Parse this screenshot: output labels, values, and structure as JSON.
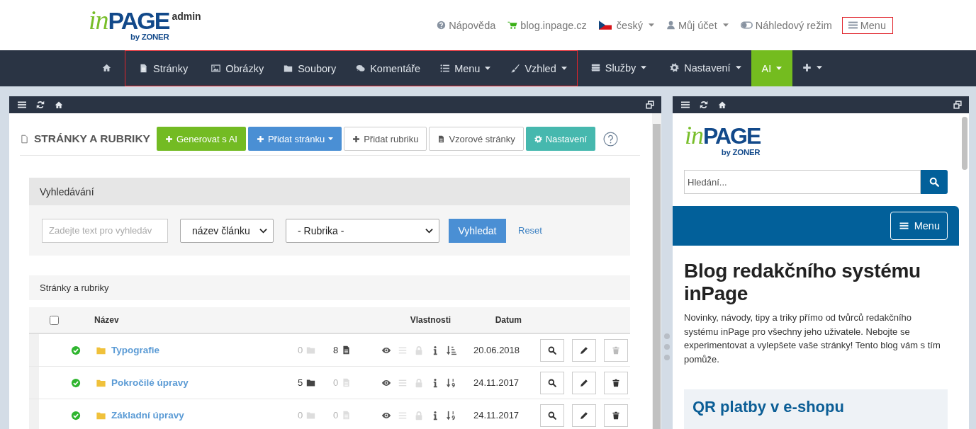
{
  "header": {
    "logo": {
      "script": "in",
      "word": "PAGE",
      "byline": "by ZONER",
      "badge": "admin"
    },
    "links": [
      {
        "label": "Nápověda"
      },
      {
        "label": "blog.inpage.cz"
      },
      {
        "label": "český",
        "dropdown": true
      },
      {
        "label": "Můj účet",
        "dropdown": true
      },
      {
        "label": "Náhledový režim"
      },
      {
        "label": "Menu",
        "highlighted": true
      }
    ]
  },
  "nav": {
    "groups": [
      {
        "items": [
          {
            "selected": false
          }
        ]
      },
      {
        "outlined": true,
        "items": [
          {
            "label": "Stránky",
            "selected": false
          },
          {
            "label": "Obrázky",
            "selected": false
          },
          {
            "label": "Soubory",
            "selected": false
          },
          {
            "label": "Komentáře",
            "selected": false
          },
          {
            "label": "Menu",
            "dropdown": true,
            "selected": false
          },
          {
            "label": "Vzhled",
            "dropdown": true,
            "selected": false
          }
        ]
      },
      {
        "items": [
          {
            "label": "Služby",
            "dropdown": true,
            "selected": false
          },
          {
            "label": "Nastavení",
            "dropdown": true,
            "selected": false
          },
          {
            "label": "AI",
            "dropdown": true,
            "selected": true
          },
          {
            "dropdown": true,
            "selected": false
          }
        ]
      }
    ]
  },
  "pages": {
    "title": "STRÁNKY A RUBRIKY",
    "buttons": [
      {
        "label": "Generovat s AI",
        "kind": "success"
      },
      {
        "label": "Přidat stránku",
        "kind": "primary",
        "dropdown": true
      },
      {
        "label": "Přidat rubriku",
        "kind": "default"
      },
      {
        "label": "Vzorové stránky",
        "kind": "default"
      },
      {
        "label": "Nastavení",
        "kind": "info"
      }
    ],
    "search": {
      "title": "Vyhledávání",
      "query": {
        "placeholder": "Zadejte text pro vyhledáv"
      },
      "field": {
        "value": "název článku"
      },
      "category": {
        "value": "- Rubrika -"
      },
      "submit": "Vyhledat",
      "reset": "Reset"
    },
    "list": {
      "title": "Stránky a rubriky",
      "select_all": {
        "checked": false
      },
      "columns": [
        "Název",
        "Vlastnosti",
        "Datum"
      ],
      "rows": [
        {
          "published": true,
          "name": "Typografie",
          "folders": "0",
          "folders_active": false,
          "pages": "8",
          "pages_active": true,
          "visible": true,
          "in_menu": false,
          "locked": false,
          "described": true,
          "numeric_sort": false,
          "date": "20.06.2018",
          "delete_disabled": true
        },
        {
          "published": true,
          "name": "Pokročilé úpravy",
          "folders": "5",
          "folders_active": true,
          "pages": "0",
          "pages_active": false,
          "visible": true,
          "in_menu": false,
          "locked": false,
          "described": true,
          "numeric_sort": true,
          "date": "24.11.2017",
          "delete_disabled": false
        },
        {
          "published": true,
          "name": "Základní úpravy",
          "folders": "0",
          "folders_active": false,
          "pages": "0",
          "pages_active": false,
          "visible": true,
          "in_menu": false,
          "locked": false,
          "described": true,
          "numeric_sort": true,
          "date": "24.11.2017",
          "delete_disabled": false
        }
      ]
    }
  },
  "preview": {
    "logo": {
      "script": "in",
      "word": "PAGE",
      "byline": "by ZONER"
    },
    "search": {
      "placeholder": "Hledání..."
    },
    "menu": "Menu",
    "heading": "Blog redakčního systému inPage",
    "intro": "Novinky, návody, tipy a triky přímo od tvůrců redakčního systému inPage pro všechny jeho uživatele. Nebojte se experimentovat a vylepšete vaše stránky! Tento blog vám s tím pomůže.",
    "card_title": "QR platby v e-shopu"
  }
}
